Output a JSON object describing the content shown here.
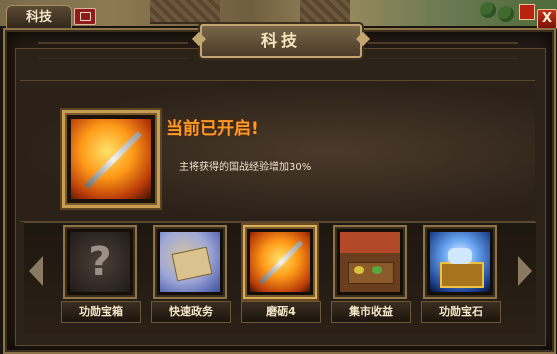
{
  "tab": {
    "label": "科技"
  },
  "window": {
    "title": "科技",
    "close_label": "X"
  },
  "selected_tech": {
    "status": "当前已开启!",
    "description": "主将获得的国战经验增加30%"
  },
  "tech_slots": [
    {
      "label": "功勋宝箱",
      "icon": "locked-question-icon",
      "active": false
    },
    {
      "label": "快速政务",
      "icon": "scroll-icon",
      "active": false
    },
    {
      "label": "磨砺4",
      "icon": "flaming-blade-icon",
      "active": true
    },
    {
      "label": "集市收益",
      "icon": "market-stall-icon",
      "active": false
    },
    {
      "label": "功勋宝石",
      "icon": "gem-chest-icon",
      "active": false
    }
  ],
  "colors": {
    "accent": "#ff9a2a",
    "frame": "#8c7448",
    "close": "#c8301c"
  }
}
